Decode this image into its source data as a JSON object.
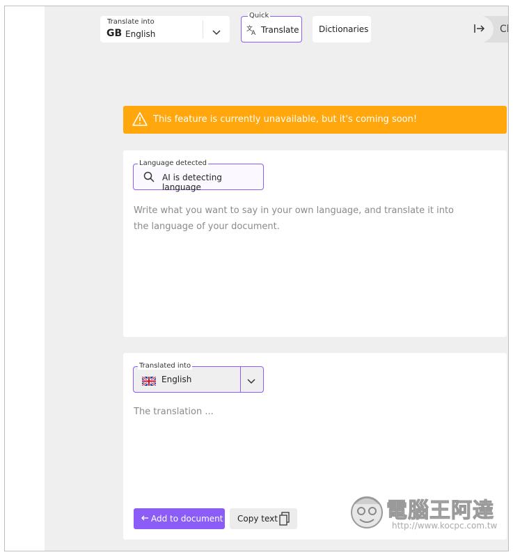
{
  "toolbar": {
    "translate_into_label": "Translate into",
    "translate_into_code": "GB",
    "translate_into_value": "English",
    "quick_label": "Quick",
    "translate_button": "Translate",
    "dictionaries_button": "Dictionaries",
    "close_button": "Close"
  },
  "banner": {
    "message": "This feature is currently unavailable, but it's coming soon!",
    "color": "#ffa70c"
  },
  "source": {
    "language_detected_label": "Language detected",
    "detecting_text": "AI is detecting  language",
    "placeholder": "Write what you want to say in your own language, and translate it into the language of your document."
  },
  "target": {
    "translated_into_label": "Translated into",
    "language": "English",
    "placeholder": "The translation ...",
    "add_button": "Add to document",
    "copy_button": "Copy text"
  },
  "watermark": {
    "title": "電腦王阿達",
    "url": "http://www.kocpc.com.tw"
  },
  "colors": {
    "accent": "#8b5cf6",
    "panel_bg": "#efefef"
  }
}
